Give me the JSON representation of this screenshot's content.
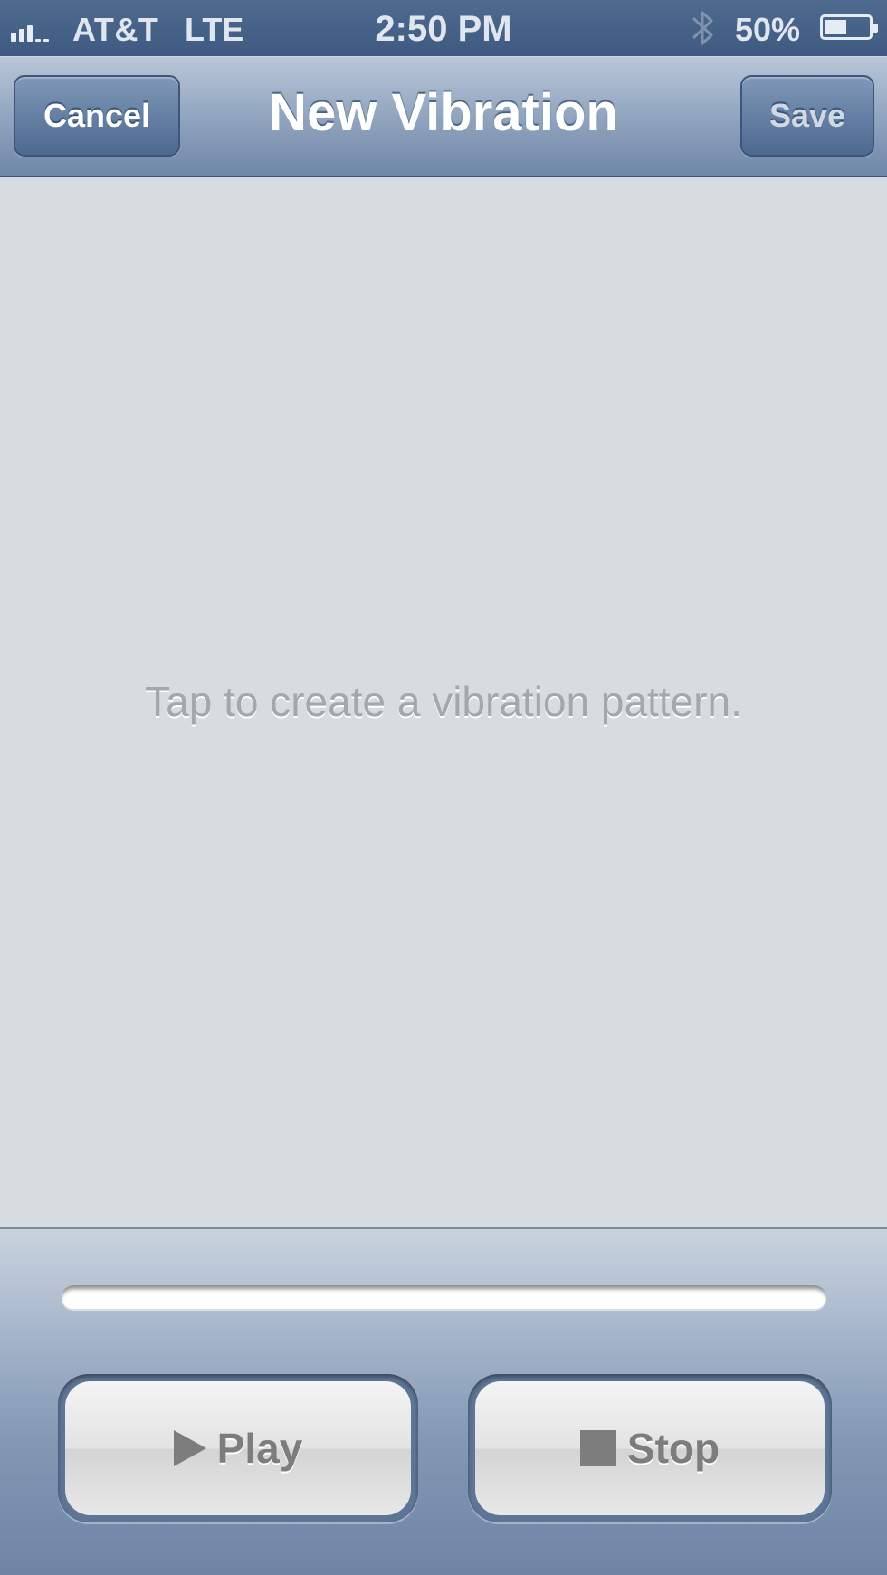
{
  "status_bar": {
    "carrier": "AT&T",
    "network": "LTE",
    "time": "2:50 PM",
    "battery_percent_label": "50%",
    "battery_level": 0.5,
    "signal_bars_filled": 3,
    "signal_bars_total": 5,
    "bluetooth_icon": "bluetooth-icon"
  },
  "nav": {
    "title": "New Vibration",
    "cancel_label": "Cancel",
    "save_label": "Save"
  },
  "canvas": {
    "hint": "Tap to create a vibration pattern."
  },
  "controls": {
    "progress": 0,
    "play_label": "Play",
    "stop_label": "Stop",
    "play_icon": "play-icon",
    "stop_icon": "stop-icon"
  },
  "colors": {
    "nav_accent": "#6f87a8",
    "background": "#d7dce1"
  }
}
